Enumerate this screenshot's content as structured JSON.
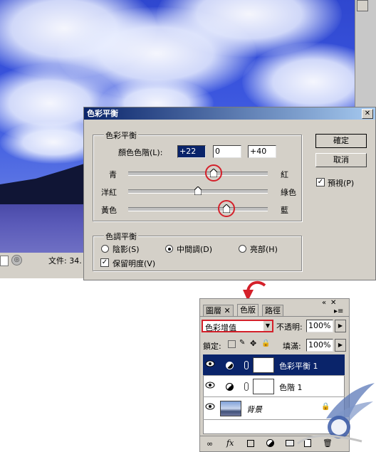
{
  "status_bar": {
    "text": "文件: 34."
  },
  "dialog": {
    "title": "色彩平衡",
    "color_balance_group": "色彩平衡",
    "levels_label": "顏色色階(L):",
    "levels": [
      "+22",
      "0",
      "+40"
    ],
    "sliders": [
      {
        "left": "青",
        "right": "紅",
        "value": 22
      },
      {
        "left": "洋紅",
        "right": "綠色",
        "value": 0
      },
      {
        "left": "黃色",
        "right": "藍",
        "value": 40
      }
    ],
    "tone_group": "色調平衡",
    "tones": [
      {
        "label": "陰影(S)",
        "selected": false
      },
      {
        "label": "中間調(D)",
        "selected": true
      },
      {
        "label": "亮部(H)",
        "selected": false
      }
    ],
    "preserve_luminosity": {
      "label": "保留明度(V)",
      "checked": true
    },
    "ok_label": "確定",
    "cancel_label": "取消",
    "preview": {
      "label": "預視(P)",
      "checked": true
    }
  },
  "layers_panel": {
    "tabs": [
      {
        "label": "圖層",
        "active": false
      },
      {
        "label": "色版",
        "active": true
      },
      {
        "label": "路徑",
        "active": false
      }
    ],
    "blend_mode": "色彩增值",
    "opacity_label": "不透明:",
    "opacity_value": "100%",
    "lock_label": "鎖定:",
    "fill_label": "填滿:",
    "fill_value": "100%",
    "layers": [
      {
        "name": "色彩平衡 1",
        "selected": true
      },
      {
        "name": "色階 1",
        "selected": false
      },
      {
        "name": "背景",
        "selected": false
      }
    ],
    "footer_icons": [
      "link-icon",
      "fx-icon",
      "mask-icon",
      "adjustment-icon",
      "folder-icon",
      "new-layer-icon",
      "trash-icon"
    ]
  },
  "colors": {
    "titlebar": "#0a246a",
    "highlight_ring": "#d4202a",
    "selected_row": "#0a246a"
  }
}
